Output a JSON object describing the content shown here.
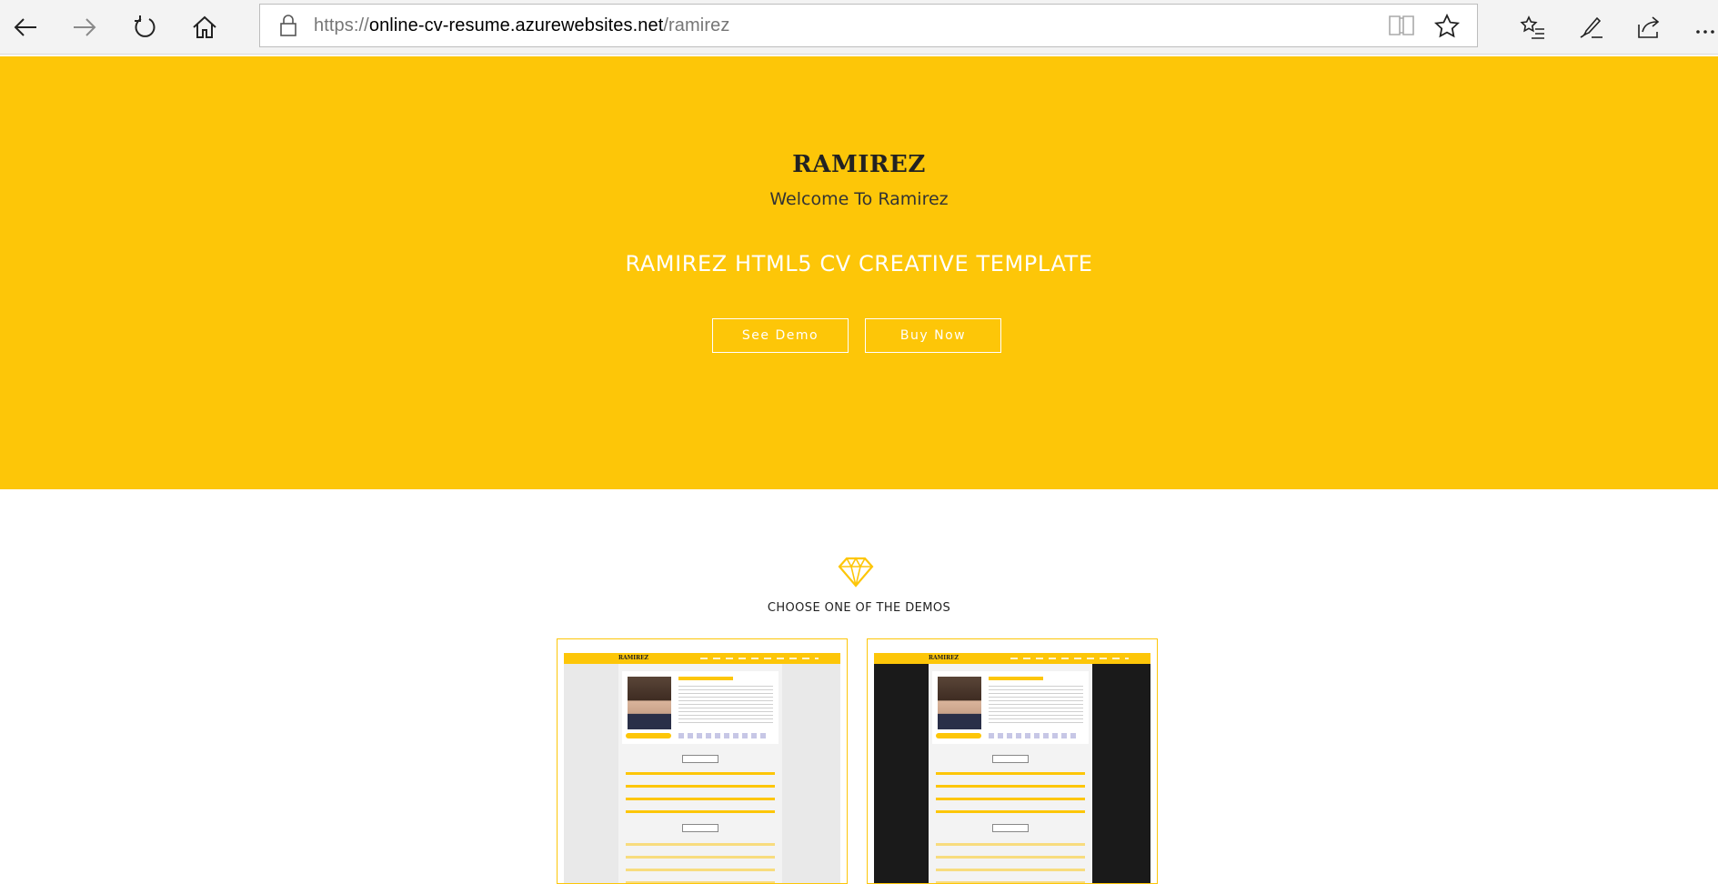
{
  "browser": {
    "url_scheme": "https://",
    "url_host": "online-cv-resume.azurewebsites.net",
    "url_path": "/ramirez",
    "icons": [
      "back-icon",
      "forward-icon",
      "refresh-icon",
      "home-icon",
      "lock-icon",
      "reading-view-icon",
      "favorite-star-icon",
      "favorites-list-icon",
      "pen-icon",
      "share-icon",
      "more-icon"
    ]
  },
  "hero": {
    "title": "RAMIREZ",
    "subtitle": "Welcome To Ramirez",
    "tagline": "RAMIREZ HTML5 CV CREATIVE TEMPLATE",
    "see_demo_label": "See Demo",
    "buy_now_label": "Buy Now",
    "bg_color": "#fdc608"
  },
  "demos": {
    "icon": "diamond-icon",
    "heading": "CHOOSE ONE OF THE DEMOS",
    "cards": [
      {
        "variant": "light"
      },
      {
        "variant": "dark"
      }
    ]
  }
}
